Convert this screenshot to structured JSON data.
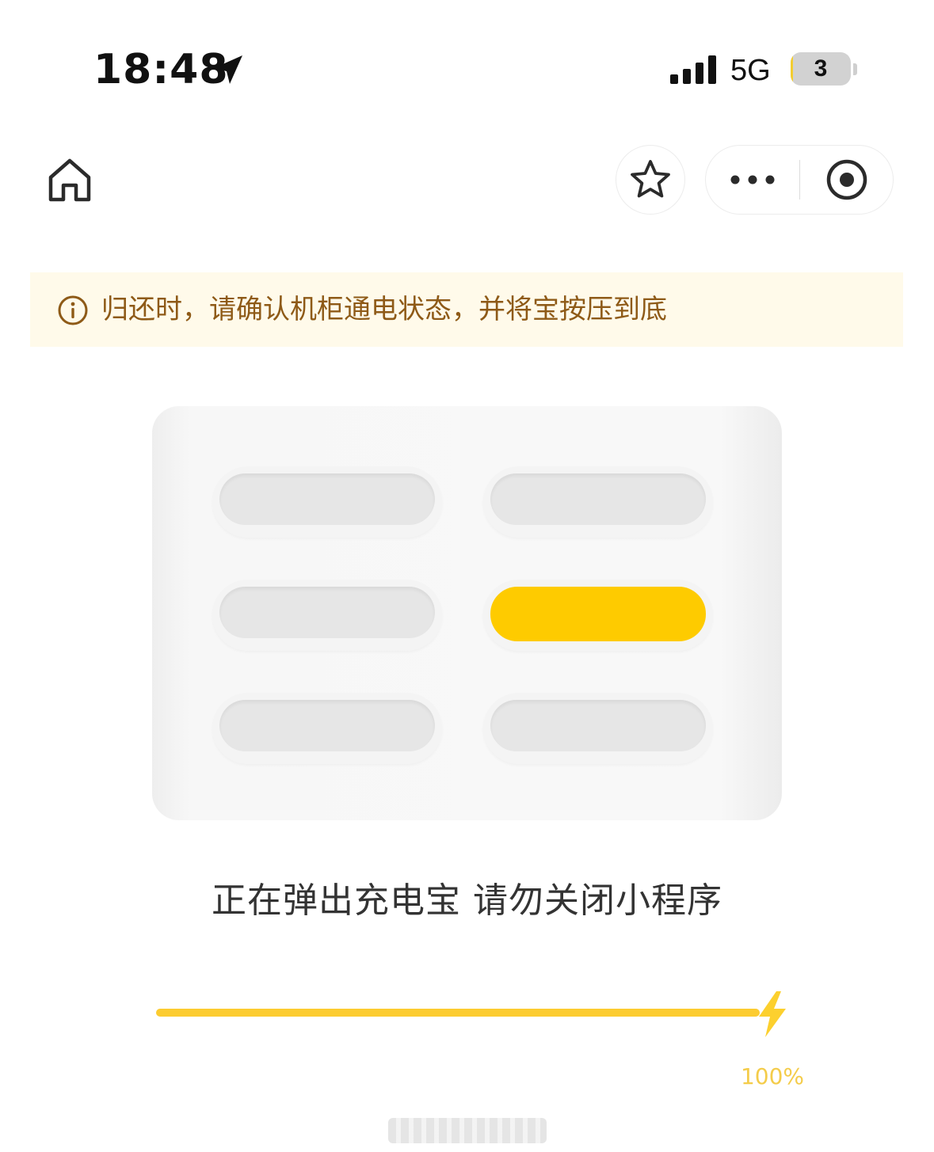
{
  "status_bar": {
    "time": "18:48",
    "network": "5G",
    "battery_level": "3",
    "battery_fraction": 0.03,
    "icons": [
      "location-arrow-icon",
      "cellular-signal-icon",
      "battery-icon"
    ]
  },
  "nav": {
    "icons": [
      "home-icon",
      "star-icon",
      "more-dots-icon",
      "close-target-icon"
    ]
  },
  "notice": {
    "icon": "info-icon",
    "text": "归还时，请确认机柜通电状态，并将宝按压到底"
  },
  "cabinet": {
    "slots": [
      {
        "state": "empty"
      },
      {
        "state": "empty"
      },
      {
        "state": "empty"
      },
      {
        "state": "ejecting"
      },
      {
        "state": "empty"
      },
      {
        "state": "empty"
      }
    ],
    "colors": {
      "active": "#fecb00",
      "empty": "#e6e6e6"
    }
  },
  "status_message": "正在弹出充电宝 请勿关闭小程序",
  "progress": {
    "fraction": 1.0,
    "label": "100%",
    "icon": "lightning-bolt-icon",
    "color": "#fccc30"
  }
}
